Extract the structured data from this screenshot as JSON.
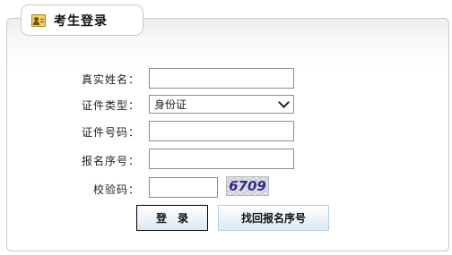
{
  "header": {
    "title": "考生登录",
    "icon": "id-card-icon"
  },
  "form": {
    "name_label": "真实姓名：",
    "name_value": "",
    "id_type_label": "证件类型：",
    "id_type_selected": "身份证",
    "id_number_label": "证件号码：",
    "id_number_value": "",
    "reg_number_label": "报名序号：",
    "reg_number_value": "",
    "captcha_label": "校验码：",
    "captcha_value": "",
    "captcha_text": "6709"
  },
  "buttons": {
    "login": "登录",
    "recover": "找回报名序号"
  }
}
